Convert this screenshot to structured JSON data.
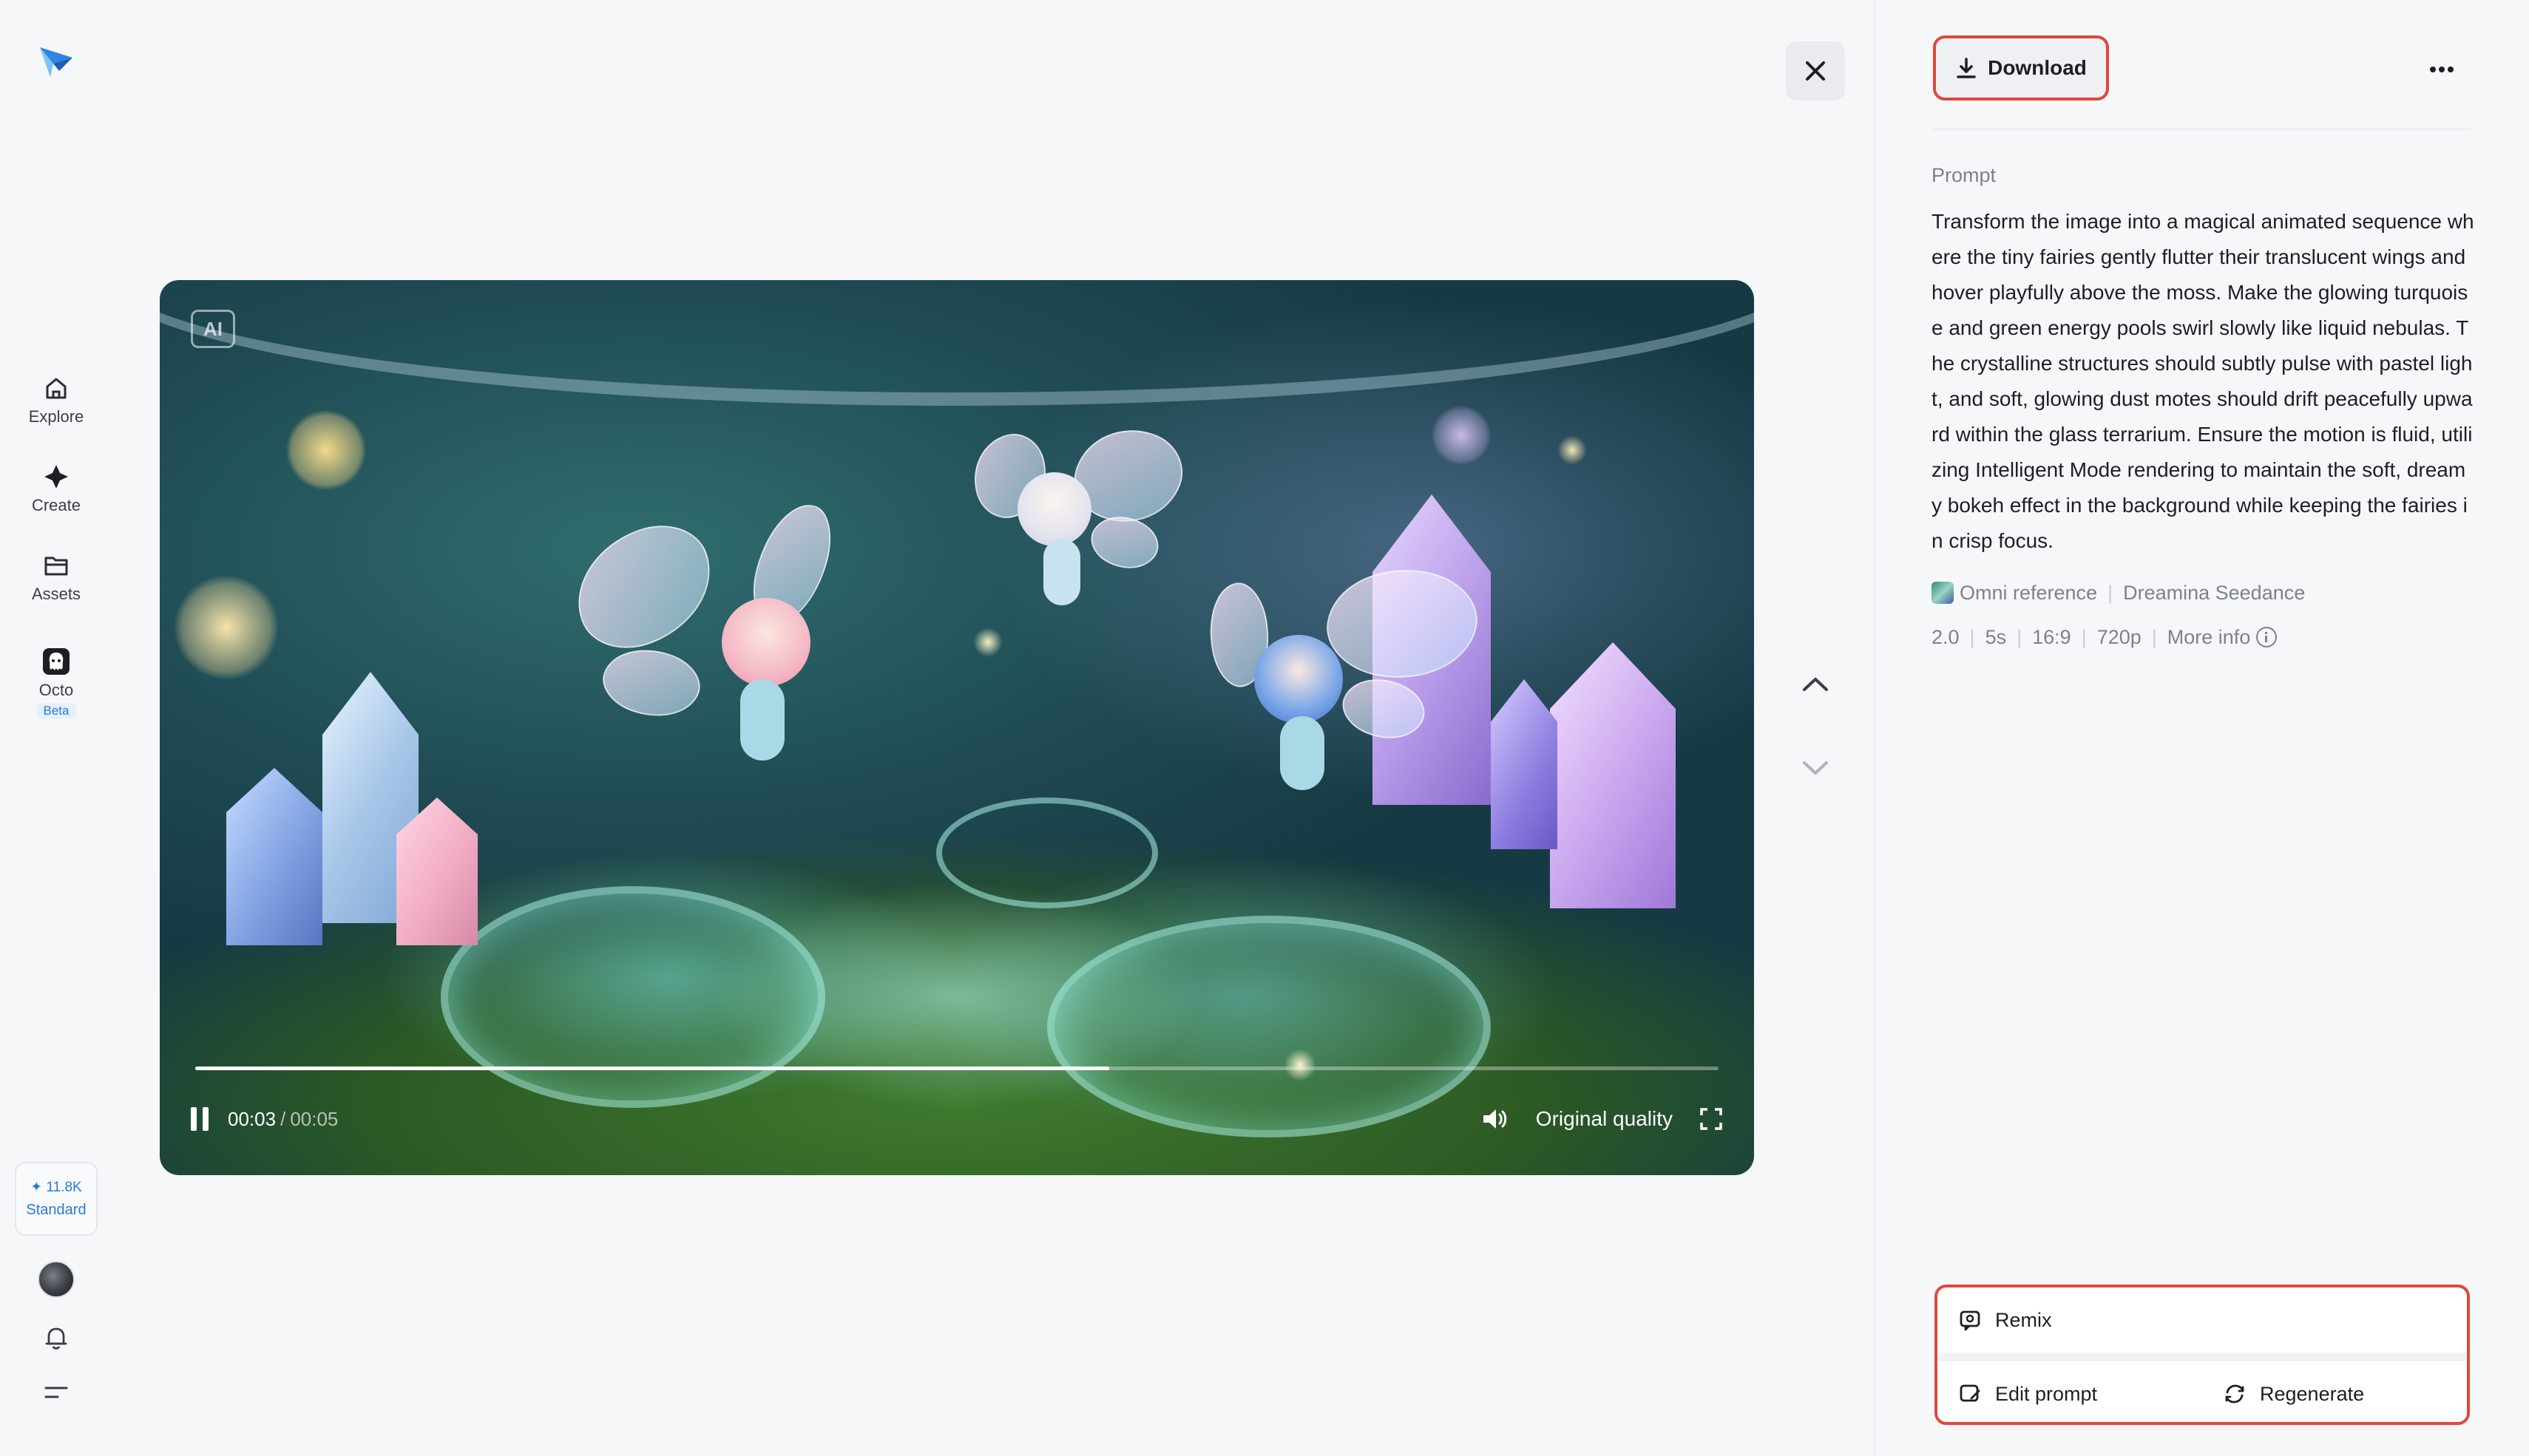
{
  "nav": {
    "items": [
      {
        "label": "Explore",
        "icon": "home-icon"
      },
      {
        "label": "Create",
        "icon": "sparkle-icon"
      },
      {
        "label": "Assets",
        "icon": "folder-icon"
      },
      {
        "label": "Octo",
        "icon": "octo-icon",
        "badge": "Beta"
      }
    ],
    "credits": {
      "amount": "✦ 11.8K",
      "tier": "Standard"
    }
  },
  "video": {
    "ai_badge": "AI",
    "time_current": "00:03",
    "time_separator": "/",
    "time_total": "00:05",
    "progress": 0.6,
    "quality": "Original quality"
  },
  "panel": {
    "download_label": "Download",
    "prompt_label": "Prompt",
    "prompt_text": "Transform the image into a magical animated sequence where the tiny fairies gently flutter their translucent wings and hover playfully above the moss. Make the glowing turquoise and green energy pools swirl slowly like liquid nebulas. The crystalline structures should subtly pulse with pastel light, and soft, glowing dust motes should drift peacefully upward within the glass terrarium. Ensure the motion is fluid, utilizing Intelligent Mode rendering to maintain the soft, dreamy bokeh effect in the background while keeping the fairies in crisp focus.",
    "meta": {
      "reference": "Omni reference",
      "model": "Dreamina Seedance 2.0",
      "duration": "5s",
      "ratio": "16:9",
      "resolution": "720p",
      "more_info": "More info"
    },
    "actions": {
      "remix": "Remix",
      "edit_prompt": "Edit prompt",
      "regenerate": "Regenerate"
    }
  },
  "colors": {
    "accent_red": "#e0483c",
    "link_blue": "#2a7ad6",
    "logo_blue": "#3b8be0"
  }
}
